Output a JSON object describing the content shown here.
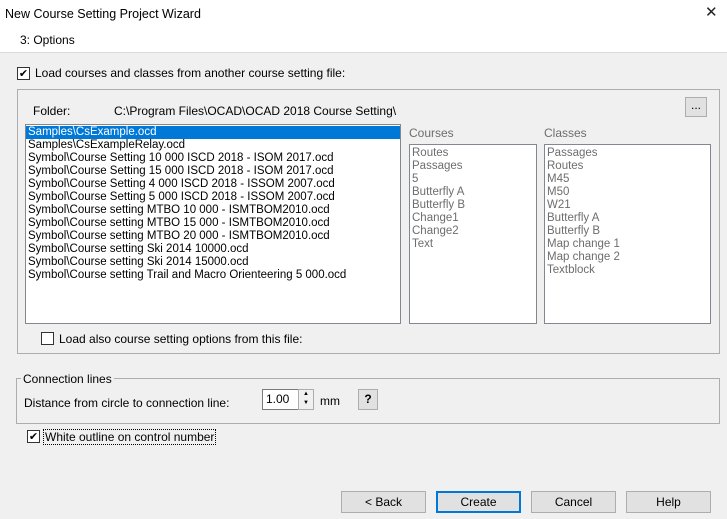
{
  "window": {
    "title": "New Course Setting Project Wizard",
    "close_glyph": "✕",
    "step_label": "3: Options"
  },
  "load_from_file": {
    "checked": true,
    "check_glyph": "✔",
    "label": "Load courses and classes from another course setting file:"
  },
  "folder": {
    "label": "Folder:",
    "path": "C:\\Program Files\\OCAD\\OCAD 2018 Course Setting\\",
    "browse_label": "..."
  },
  "files": {
    "selected_index": 0,
    "items": [
      "Samples\\CsExample.ocd",
      "Samples\\CsExampleRelay.ocd",
      "Symbol\\Course Setting 10 000 ISCD 2018 - ISOM 2017.ocd",
      "Symbol\\Course Setting 15 000 ISCD 2018 - ISOM 2017.ocd",
      "Symbol\\Course Setting 4 000 ISCD 2018 - ISSOM 2007.ocd",
      "Symbol\\Course Setting 5 000 ISCD 2018 - ISSOM 2007.ocd",
      "Symbol\\Course setting MTBO 10 000 - ISMTBOM2010.ocd",
      "Symbol\\Course setting MTBO 15 000 - ISMTBOM2010.ocd",
      "Symbol\\Course setting MTBO 20 000 - ISMTBOM2010.ocd",
      "Symbol\\Course setting Ski 2014 10000.ocd",
      "Symbol\\Course setting Ski 2014 15000.ocd",
      "Symbol\\Course setting Trail and Macro Orienteering 5 000.ocd"
    ]
  },
  "courses": {
    "label": "Courses",
    "items": [
      "Routes",
      "Passages",
      "5",
      "Butterfly A",
      "Butterfly B",
      "Change1",
      "Change2",
      "Text"
    ]
  },
  "classes": {
    "label": "Classes",
    "items": [
      "Passages",
      "Routes",
      "M45",
      "M50",
      "W21",
      "Butterfly A",
      "Butterfly B",
      "Map change 1",
      "Map change 2",
      "Textblock"
    ]
  },
  "load_options": {
    "checked": false,
    "label": "Load also course setting options from this file:"
  },
  "connection_lines": {
    "group_label": "Connection lines",
    "distance_label": "Distance from circle to connection line:",
    "distance_value": "1.00",
    "up_glyph": "▲",
    "down_glyph": "▼",
    "unit": "mm",
    "help_label": "?"
  },
  "white_outline": {
    "checked": true,
    "check_glyph": "✔",
    "label": "White outline on control number"
  },
  "buttons": {
    "back": "< Back",
    "create": "Create",
    "cancel": "Cancel",
    "help": "Help"
  }
}
